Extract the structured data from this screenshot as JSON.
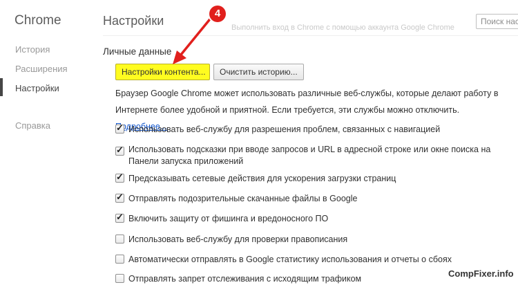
{
  "app": {
    "title": "Chrome"
  },
  "sidebar": {
    "items": [
      {
        "label": "История",
        "selected": false
      },
      {
        "label": "Расширения",
        "selected": false
      },
      {
        "label": "Настройки",
        "selected": true
      },
      {
        "label": "Справка",
        "selected": false
      }
    ]
  },
  "header": {
    "title": "Настройки",
    "search_placeholder": "Поиск настроек",
    "ghost_text": "Выполнить вход в Chrome с помощью аккаунта Google Chrome"
  },
  "privacy": {
    "section_title": "Личные данные",
    "content_settings_button": "Настройки контента...",
    "clear_history_button": "Очистить историю...",
    "description": "Браузер Google Chrome может использовать различные веб-службы, которые делают работу в Интернете более удобной и приятной. Если требуется, эти службы можно отключить.",
    "learn_more": "Подробнее...",
    "options": [
      {
        "label": "Использовать веб-службу для разрешения проблем, связанных с навигацией",
        "checked": true
      },
      {
        "label": "Использовать подсказки при вводе запросов и URL в адресной строке или окне поиска на Панели запуска приложений",
        "checked": true
      },
      {
        "label": "Предсказывать сетевые действия для ускорения загрузки страниц",
        "checked": true
      },
      {
        "label": "Отправлять подозрительные скачанные файлы в Google",
        "checked": true
      },
      {
        "label": "Включить защиту от фишинга и вредоносного ПО",
        "checked": true
      },
      {
        "label": "Использовать веб-службу для проверки правописания",
        "checked": false
      },
      {
        "label": "Автоматически отправлять в Google статистику использования и отчеты о сбоях",
        "checked": false
      },
      {
        "label": "Отправлять запрет отслеживания с исходящим трафиком",
        "checked": false
      }
    ]
  },
  "annotation": {
    "step": "4",
    "color": "#e1201d"
  },
  "watermark": "CompFixer.info",
  "colors": {
    "highlight_button": "#fffc20",
    "link": "#1155cc"
  }
}
